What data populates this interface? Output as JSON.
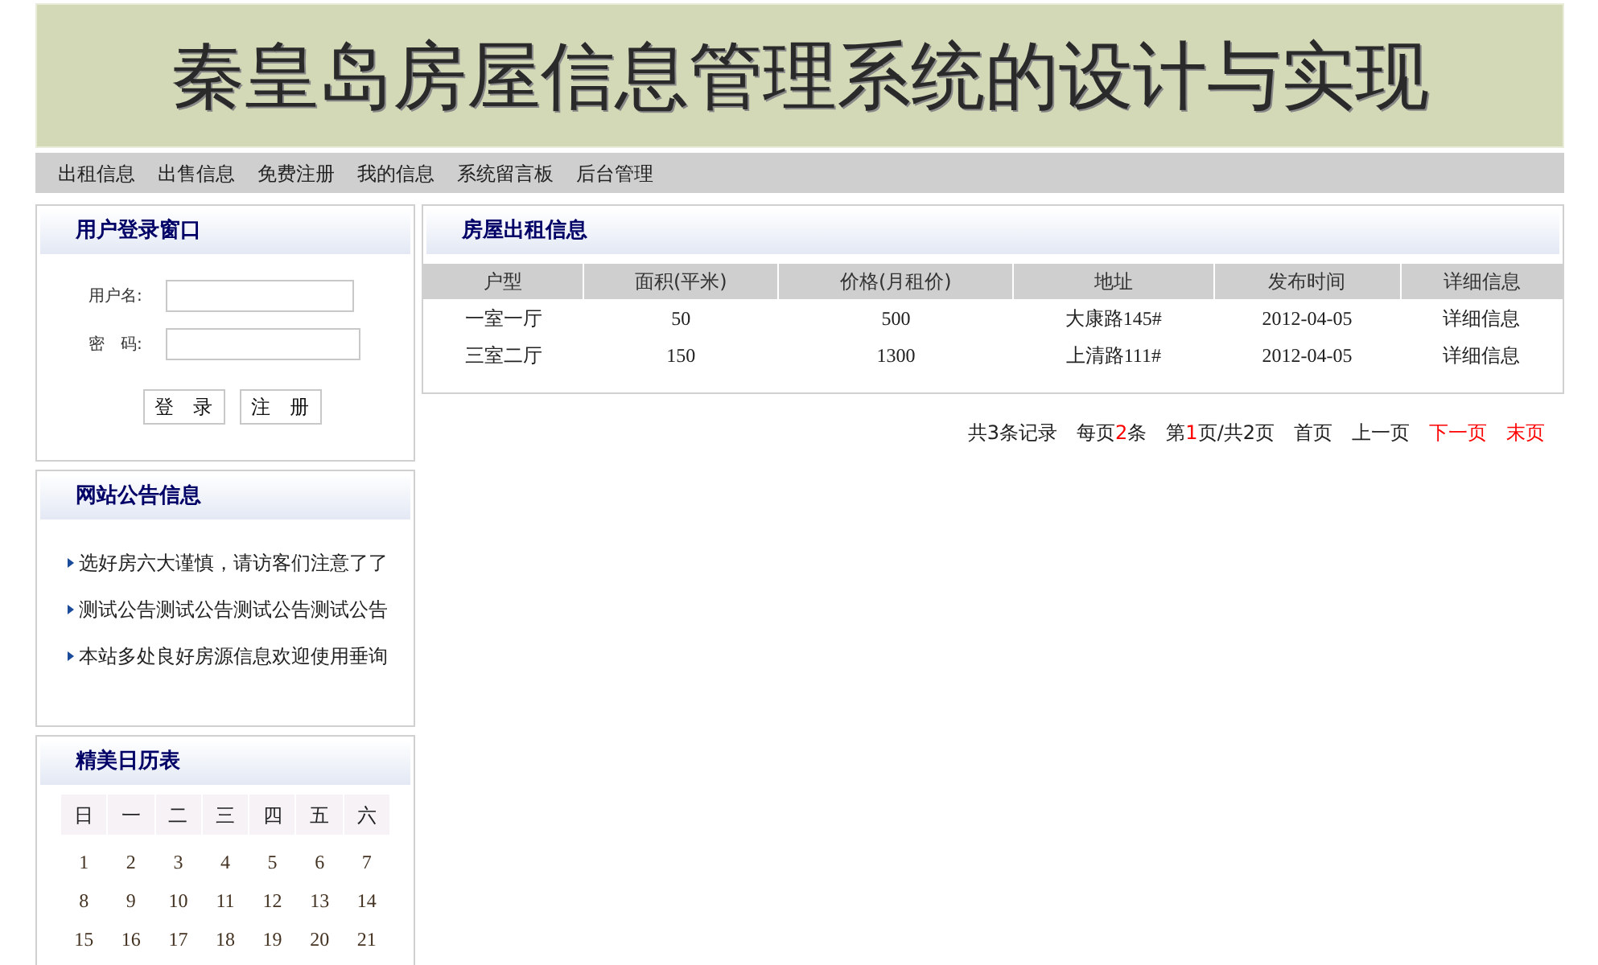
{
  "banner": {
    "title": "秦皇岛房屋信息管理系统的设计与实现"
  },
  "nav": [
    "出租信息",
    "出售信息",
    "免费注册",
    "我的信息",
    "系统留言板",
    "后台管理"
  ],
  "login": {
    "title": "用户登录窗口",
    "fields": [
      {
        "label": "用户名:"
      },
      {
        "label": "密　码:"
      }
    ],
    "buttons": [
      "登　录",
      "注　册"
    ]
  },
  "notices": {
    "title": "网站公告信息",
    "items": [
      "选好房六大谨慎，请访客们注意了了",
      "测试公告测试公告测试公告测试公告",
      "本站多处良好房源信息欢迎使用垂询"
    ]
  },
  "calendar": {
    "title": "精美日历表",
    "weekdays": [
      "日",
      "一",
      "二",
      "三",
      "四",
      "五",
      "六"
    ],
    "weeks": [
      [
        "1",
        "2",
        "3",
        "4",
        "5",
        "6",
        "7"
      ],
      [
        "8",
        "9",
        "10",
        "11",
        "12",
        "13",
        "14"
      ],
      [
        "15",
        "16",
        "17",
        "18",
        "19",
        "20",
        "21"
      ]
    ]
  },
  "rentals": {
    "title": "房屋出租信息",
    "columns": [
      "户型",
      "面积(平米)",
      "价格(月租价)",
      "地址",
      "发布时间",
      "详细信息"
    ],
    "rows": [
      [
        "一室一厅",
        "50",
        "500",
        "大康路145#",
        "2012-04-05",
        "详细信息"
      ],
      [
        "三室二厅",
        "150",
        "1300",
        "上清路111#",
        "2012-04-05",
        "详细信息"
      ]
    ]
  },
  "pagination": {
    "info": [
      [
        {
          "text": "共3条记录",
          "highlight": false
        }
      ],
      [
        {
          "text": "每页",
          "highlight": false
        },
        {
          "text": "2",
          "highlight": true
        },
        {
          "text": "条",
          "highlight": false
        }
      ],
      [
        {
          "text": "第",
          "highlight": false
        },
        {
          "text": "1",
          "highlight": true
        },
        {
          "text": "页/共2页",
          "highlight": false
        }
      ]
    ],
    "links": [
      {
        "label": "首页",
        "enabled": false
      },
      {
        "label": "上一页",
        "enabled": false
      },
      {
        "label": "下一页",
        "enabled": true
      },
      {
        "label": "末页",
        "enabled": true
      }
    ]
  }
}
